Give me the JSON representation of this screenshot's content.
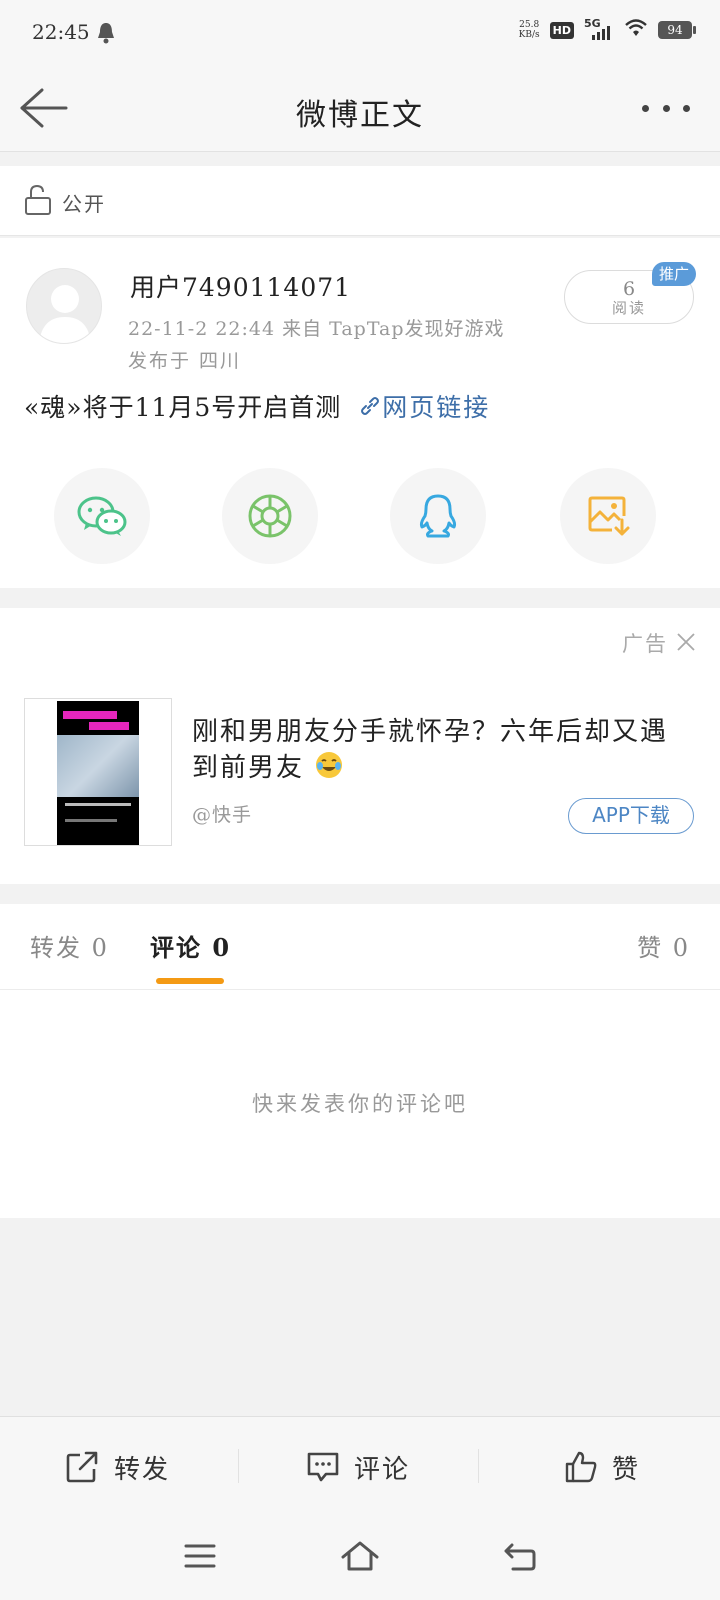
{
  "status_bar": {
    "time": "22:45",
    "net_speed_value": "25.8",
    "net_speed_unit": "KB/s",
    "hd_label": "HD",
    "network_label": "5G",
    "battery": "94"
  },
  "header": {
    "title": "微博正文"
  },
  "visibility": {
    "label": "公开"
  },
  "post": {
    "username": "用户7490114071",
    "meta": "22-11-2 22:44  来自 TapTap发现好游戏",
    "location": "发布于 四川",
    "read_count": "6",
    "read_label": "阅读",
    "promo_badge": "推广",
    "text": "«魂»将于11月5号开启首测",
    "link_text": "网页链接",
    "share_targets": [
      "wechat",
      "moments",
      "qq",
      "save-image"
    ]
  },
  "ad": {
    "tag": "广告",
    "title": "刚和男朋友分手就怀孕？六年后却又遇到前男友",
    "source": "@快手",
    "button": "APP下载"
  },
  "tabs": {
    "repost": "转发 0",
    "comment": "评论 0",
    "like": "赞 0"
  },
  "comments": {
    "empty_text": "快来发表你的评论吧"
  },
  "actions": {
    "repost": "转发",
    "comment": "评论",
    "like": "赞"
  },
  "colors": {
    "accent_orange": "#f49a14",
    "link_blue": "#3d6ea8",
    "wechat_green": "#4cc38a",
    "moments_green": "#7ac36a",
    "qq_blue": "#37a8e0",
    "save_orange": "#f4b23a",
    "promo_blue": "#5b9bd9"
  }
}
